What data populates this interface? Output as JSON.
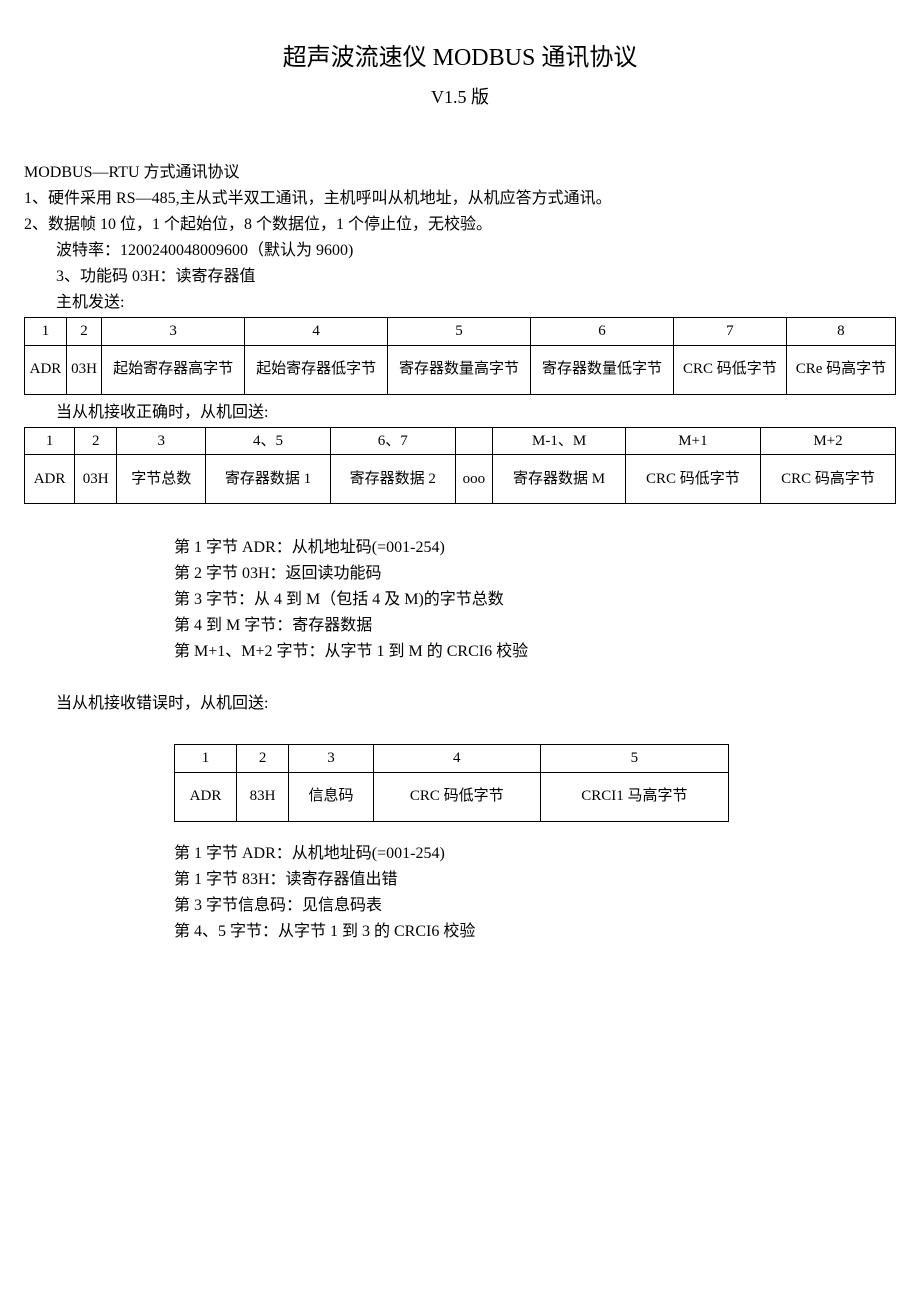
{
  "title": "超声波流速仪 MODBUS 通讯协议",
  "version": "V1.5 版",
  "protoHeader": "MODBUS—RTU 方式通讯协议",
  "line1": "1、硬件采用 RS—485,主从式半双工通讯，主机呼叫从机地址，从机应答方式通讯。",
  "line2": "2、数据帧 10 位，1 个起始位，8 个数据位，1 个停止位，无校验。",
  "baud": "波特率：1200240048009600（默认为 9600)",
  "line3": "3、功能码 03H：读寄存器值",
  "hostSend": "主机发送:",
  "table1": {
    "h": [
      "1",
      "2",
      "3",
      "4",
      "5",
      "6",
      "7",
      "8"
    ],
    "r": [
      "ADR",
      "03H",
      "起始寄存器高字节",
      "起始寄存器低字节",
      "寄存器数量高字节",
      "寄存器数量低字节",
      "CRC 码低字节",
      "CRe 码高字节"
    ]
  },
  "slaveOk": "当从机接收正确时，从机回送:",
  "table2": {
    "h": [
      "1",
      "2",
      "3",
      "4、5",
      "6、7",
      "",
      "M-1、M",
      "M+1",
      "M+2"
    ],
    "r": [
      "ADR",
      "03H",
      "字节总数",
      "寄存器数据 1",
      "寄存器数据 2",
      "ooo",
      "寄存器数据 M",
      "CRC 码低字节",
      "CRC 码高字节"
    ]
  },
  "desc1": [
    "第 1 字节 ADR：从机地址码(=001-254)",
    "第 2 字节 03H：返回读功能码",
    "第 3 字节：从 4 到 M（包括 4 及 M)的字节总数",
    "第 4 到 M 字节：寄存器数据",
    "第 M+1、M+2 字节：从字节 1 到 M 的 CRCI6 校验"
  ],
  "slaveErr": "当从机接收错误时，从机回送:",
  "table3": {
    "h": [
      "1",
      "2",
      "3",
      "4",
      "5"
    ],
    "r": [
      "ADR",
      "83H",
      "信息码",
      "CRC 码低字节",
      "CRCI1 马高字节"
    ]
  },
  "desc2": [
    "第 1 字节 ADR：从机地址码(=001-254)",
    "第 1 字节 83H：读寄存器值出错",
    "第 3 字节信息码：见信息码表",
    "第 4、5 字节：从字节 1 到 3 的 CRCI6 校验"
  ]
}
